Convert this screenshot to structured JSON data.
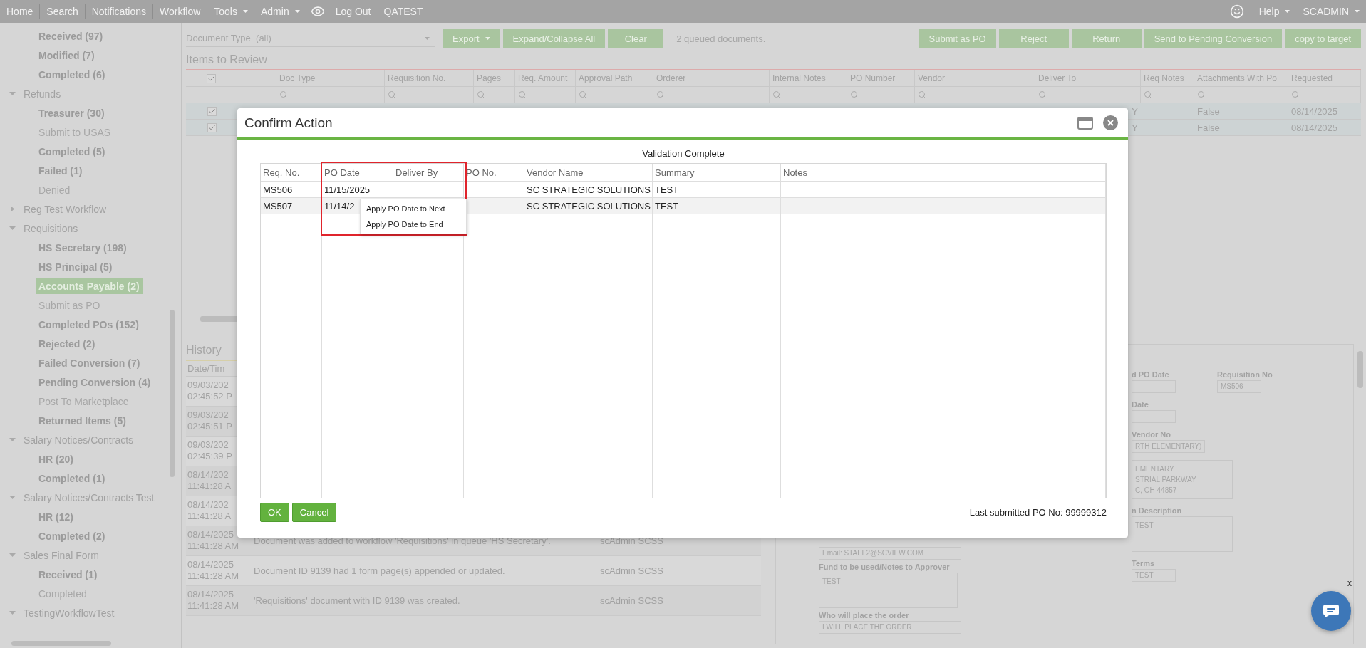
{
  "top_nav": {
    "left": [
      {
        "kind": "link",
        "label": "Home",
        "dropdown": false
      },
      {
        "kind": "link",
        "label": "Search",
        "dropdown": false
      },
      {
        "kind": "link",
        "label": "Notifications",
        "dropdown": false
      },
      {
        "kind": "link",
        "label": "Workflow",
        "dropdown": false
      },
      {
        "kind": "link",
        "label": "Tools",
        "dropdown": true
      },
      {
        "kind": "link",
        "label": "Admin",
        "dropdown": true
      },
      {
        "kind": "icon"
      },
      {
        "kind": "link",
        "label": "Log Out",
        "dropdown": false
      },
      {
        "kind": "link",
        "label": "QATEST",
        "dropdown": false
      }
    ],
    "right": [
      {
        "kind": "icon"
      },
      {
        "kind": "link",
        "label": "Help",
        "dropdown": true
      },
      {
        "kind": "link",
        "label": "SCADMIN",
        "dropdown": true
      }
    ]
  },
  "sidebar": {
    "tree": [
      {
        "kind": "group",
        "children": [
          {
            "kind": "queue",
            "label": "Received (97)",
            "emphasized": true,
            "selected": false
          },
          {
            "kind": "queue",
            "label": "Modified (7)",
            "emphasized": true,
            "selected": false
          },
          {
            "kind": "queue",
            "label": "Completed (6)",
            "emphasized": true,
            "selected": false
          }
        ]
      },
      {
        "kind": "group",
        "label": "Refunds",
        "expanded": true,
        "children": [
          {
            "kind": "queue",
            "label": "Treasurer (30)",
            "emphasized": true,
            "selected": false
          },
          {
            "kind": "queue",
            "label": "Submit to USAS",
            "emphasized": false,
            "selected": false
          },
          {
            "kind": "queue",
            "label": "Completed (5)",
            "emphasized": true,
            "selected": false
          },
          {
            "kind": "queue",
            "label": "Failed (1)",
            "emphasized": true,
            "selected": false
          },
          {
            "kind": "queue",
            "label": "Denied",
            "emphasized": false,
            "selected": false
          }
        ]
      },
      {
        "kind": "group",
        "label": "Reg Test Workflow",
        "expanded": false
      },
      {
        "kind": "group",
        "label": "Requisitions",
        "expanded": true,
        "children": [
          {
            "kind": "queue",
            "label": "HS Secretary (198)",
            "emphasized": true,
            "selected": false
          },
          {
            "kind": "queue",
            "label": "HS Principal (5)",
            "emphasized": true,
            "selected": false
          },
          {
            "kind": "queue",
            "label": "Accounts Payable (2)",
            "emphasized": true,
            "selected": true
          },
          {
            "kind": "queue",
            "label": "Submit as PO",
            "emphasized": false,
            "selected": false
          },
          {
            "kind": "queue",
            "label": "Completed POs (152)",
            "emphasized": true,
            "selected": false
          },
          {
            "kind": "queue",
            "label": "Rejected (2)",
            "emphasized": true,
            "selected": false
          },
          {
            "kind": "queue",
            "label": "Failed Conversion (7)",
            "emphasized": true,
            "selected": false
          },
          {
            "kind": "queue",
            "label": "Pending Conversion (4)",
            "emphasized": true,
            "selected": false
          },
          {
            "kind": "queue",
            "label": "Post To Marketplace",
            "emphasized": false,
            "selected": false
          },
          {
            "kind": "queue",
            "label": "Returned Items (5)",
            "emphasized": true,
            "selected": false
          }
        ]
      },
      {
        "kind": "group",
        "label": "Salary Notices/Contracts",
        "expanded": true,
        "children": [
          {
            "kind": "queue",
            "label": "HR (20)",
            "emphasized": true,
            "selected": false
          },
          {
            "kind": "queue",
            "label": "Completed (1)",
            "emphasized": true,
            "selected": false
          }
        ]
      },
      {
        "kind": "group",
        "label": "Salary Notices/Contracts Test",
        "expanded": true,
        "children": [
          {
            "kind": "queue",
            "label": "HR (12)",
            "emphasized": true,
            "selected": false
          },
          {
            "kind": "queue",
            "label": "Completed (2)",
            "emphasized": true,
            "selected": false
          }
        ]
      },
      {
        "kind": "group",
        "label": "Sales Final Form",
        "expanded": true,
        "children": [
          {
            "kind": "queue",
            "label": "Received (1)",
            "emphasized": true,
            "selected": false
          },
          {
            "kind": "queue",
            "label": "Completed",
            "emphasized": false,
            "selected": false
          }
        ]
      },
      {
        "kind": "group",
        "label": "TestingWorkflowTest",
        "expanded": true
      }
    ]
  },
  "toolbar": {
    "document_type": {
      "label": "Document Type",
      "value": "(all)"
    },
    "buttons_left": [
      {
        "label": "Export",
        "dropdown": true
      },
      {
        "label": "Expand/Collapse All",
        "dropdown": false
      },
      {
        "label": "Clear",
        "dropdown": false
      }
    ],
    "status": "2 queued documents.",
    "buttons_right": [
      "Submit as PO",
      "Reject",
      "Return",
      "Send to Pending Conversion",
      "copy to target"
    ]
  },
  "items_to_review": {
    "title": "Items to Review",
    "all_checked": true,
    "columns": [
      "Doc Type",
      "Requisition No.",
      "Pages",
      "Req. Amount",
      "Approval Path",
      "Orderer",
      "Internal Notes",
      "PO Number",
      "Vendor",
      "Deliver To",
      "Req Notes",
      "Attachments With Po",
      "Requested"
    ],
    "rows": [
      {
        "checked": true,
        "deliver_to": "Y",
        "attachments_with_po": "False",
        "requested": "08/14/2025"
      },
      {
        "checked": true,
        "deliver_to": "Y",
        "attachments_with_po": "False",
        "requested": "08/14/2025"
      }
    ]
  },
  "history": {
    "title": "History",
    "columns": [
      "Date/Tim"
    ],
    "rows": [
      {
        "date": "09/03/202",
        "time": "02:45:52 P"
      },
      {
        "date": "09/03/202",
        "time": "02:45:51 P"
      },
      {
        "date": "09/03/202",
        "time": "02:45:39 P"
      },
      {
        "date": "08/14/202",
        "time": "11:41:28 A"
      },
      {
        "date": "08/14/202",
        "time": "11:41:28 A"
      },
      {
        "date": "08/14/2025",
        "time": "11:41:28 AM",
        "description": "Document was added to workflow 'Requisitions' in queue 'HS Secretary'.",
        "user": "scAdmin SCSS"
      },
      {
        "date": "08/14/2025",
        "time": "11:41:28 AM",
        "description": "Document ID 9139 had 1 form page(s) appended or updated.",
        "user": "scAdmin SCSS"
      },
      {
        "date": "08/14/2025",
        "time": "11:41:28 AM",
        "description": "'Requisitions' document with ID 9139 was created.",
        "user": "scAdmin SCSS"
      }
    ]
  },
  "details": {
    "left": [
      {
        "kind": "input",
        "value": "Email: STAFF2@SCVIEW.COM"
      },
      {
        "kind": "area",
        "label": "Fund to be used/Notes to Approver",
        "lines": [
          "TEST"
        ]
      },
      {
        "kind": "input",
        "label": "Who will place the order",
        "value": "I WILL PLACE THE ORDER"
      }
    ],
    "right": [
      [
        {
          "kind": "input",
          "label": "d PO Date"
        },
        {
          "kind": "input",
          "label": "Requisition No",
          "value": "MS506"
        }
      ],
      [
        {
          "kind": "input",
          "label": "Date"
        }
      ],
      [
        {
          "kind": "input",
          "label": "Vendor No",
          "value": "RTH ELEMENTARY)"
        }
      ],
      [
        {
          "kind": "area",
          "lines": [
            "EMENTARY",
            "STRIAL PARKWAY",
            "C, OH 44857"
          ]
        }
      ],
      [
        {
          "kind": "area",
          "label": "n Description",
          "lines": [
            "TEST"
          ]
        }
      ],
      [
        {
          "kind": "input",
          "label": "Terms",
          "value": "TEST"
        }
      ]
    ]
  },
  "modal": {
    "title": "Confirm Action",
    "heading": "Validation Complete",
    "columns": [
      "Req. No.",
      "PO Date",
      "Deliver By",
      "PO No.",
      "Vendor Name",
      "Summary",
      "Notes"
    ],
    "rows": [
      {
        "req_no": "MS506",
        "po_date": "11/15/2025",
        "vendor_name": "SC STRATEGIC SOLUTIONS",
        "summary": "TEST",
        "selected": false
      },
      {
        "req_no": "MS507",
        "po_date": "11/14/2",
        "vendor_name": "SC STRATEGIC SOLUTIONS",
        "summary": "TEST",
        "selected": true
      }
    ],
    "context_menu": [
      "Apply PO Date to Next",
      "Apply PO Date to End"
    ],
    "buttons": [
      "OK",
      "Cancel"
    ],
    "last_submitted": "Last submitted PO No: 99999312"
  },
  "chat_widget": {
    "close": "x"
  }
}
